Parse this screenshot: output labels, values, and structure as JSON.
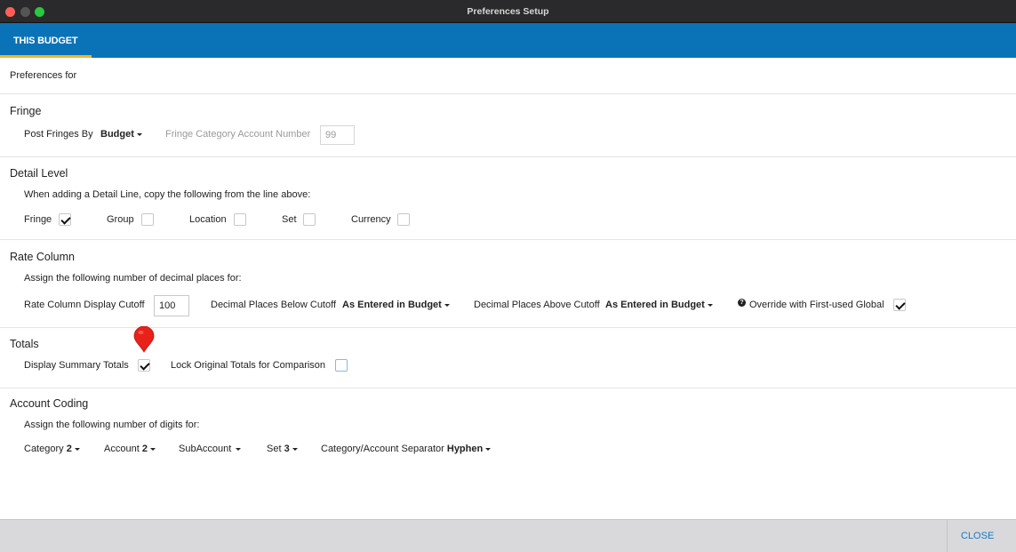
{
  "window": {
    "title": "Preferences Setup"
  },
  "tabs": [
    {
      "label": "THIS BUDGET"
    }
  ],
  "header": {
    "preferences_for": "Preferences for"
  },
  "fringe": {
    "title": "Fringe",
    "post_label": "Post Fringes By",
    "post_value": "Budget",
    "category_label": "Fringe Category Account Number",
    "category_value": "99"
  },
  "detail_level": {
    "title": "Detail Level",
    "instruction": "When adding a Detail Line, copy the following from the line above:",
    "options": [
      {
        "label": "Fringe",
        "checked": true
      },
      {
        "label": "Group",
        "checked": false
      },
      {
        "label": "Location",
        "checked": false
      },
      {
        "label": "Set",
        "checked": false
      },
      {
        "label": "Currency",
        "checked": false
      }
    ]
  },
  "rate_column": {
    "title": "Rate Column",
    "instruction": "Assign the following number of decimal places for:",
    "cutoff_label": "Rate Column Display Cutoff",
    "cutoff_value": "100",
    "below_label": "Decimal Places Below Cutoff",
    "below_value": "As Entered in Budget",
    "above_label": "Decimal Places Above Cutoff",
    "above_value": "As Entered in Budget",
    "override_label": "Override with First-used Global",
    "override_checked": true
  },
  "totals": {
    "title": "Totals",
    "display_label": "Display Summary Totals",
    "display_checked": true,
    "lock_label": "Lock Original Totals for Comparison",
    "lock_checked": false
  },
  "account_coding": {
    "title": "Account Coding",
    "instruction": "Assign the following number of digits for:",
    "category_label": "Category",
    "category_value": "2",
    "account_label": "Account",
    "account_value": "2",
    "subaccount_label": "SubAccount",
    "subaccount_value": "",
    "set_label": "Set",
    "set_value": "3",
    "separator_label": "Category/Account Separator",
    "separator_value": "Hyphen"
  },
  "footer": {
    "close_label": "CLOSE"
  },
  "colors": {
    "accent": "#0a73b7",
    "tab_underline": "#f4b521",
    "pin": "#e8211a",
    "link": "#1a78c2"
  }
}
